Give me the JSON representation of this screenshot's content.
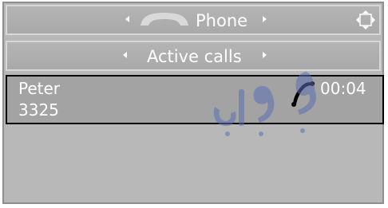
{
  "header": {
    "title": "Phone",
    "icon": "handset-icon"
  },
  "subheader": {
    "title": "Active calls"
  },
  "call": {
    "name": "Peter",
    "number": "3325",
    "duration": "00:04",
    "icon": "phone-active-icon"
  },
  "colors": {
    "background": "#b8b8b8",
    "text": "#ffffff",
    "selection_border": "#000000"
  }
}
